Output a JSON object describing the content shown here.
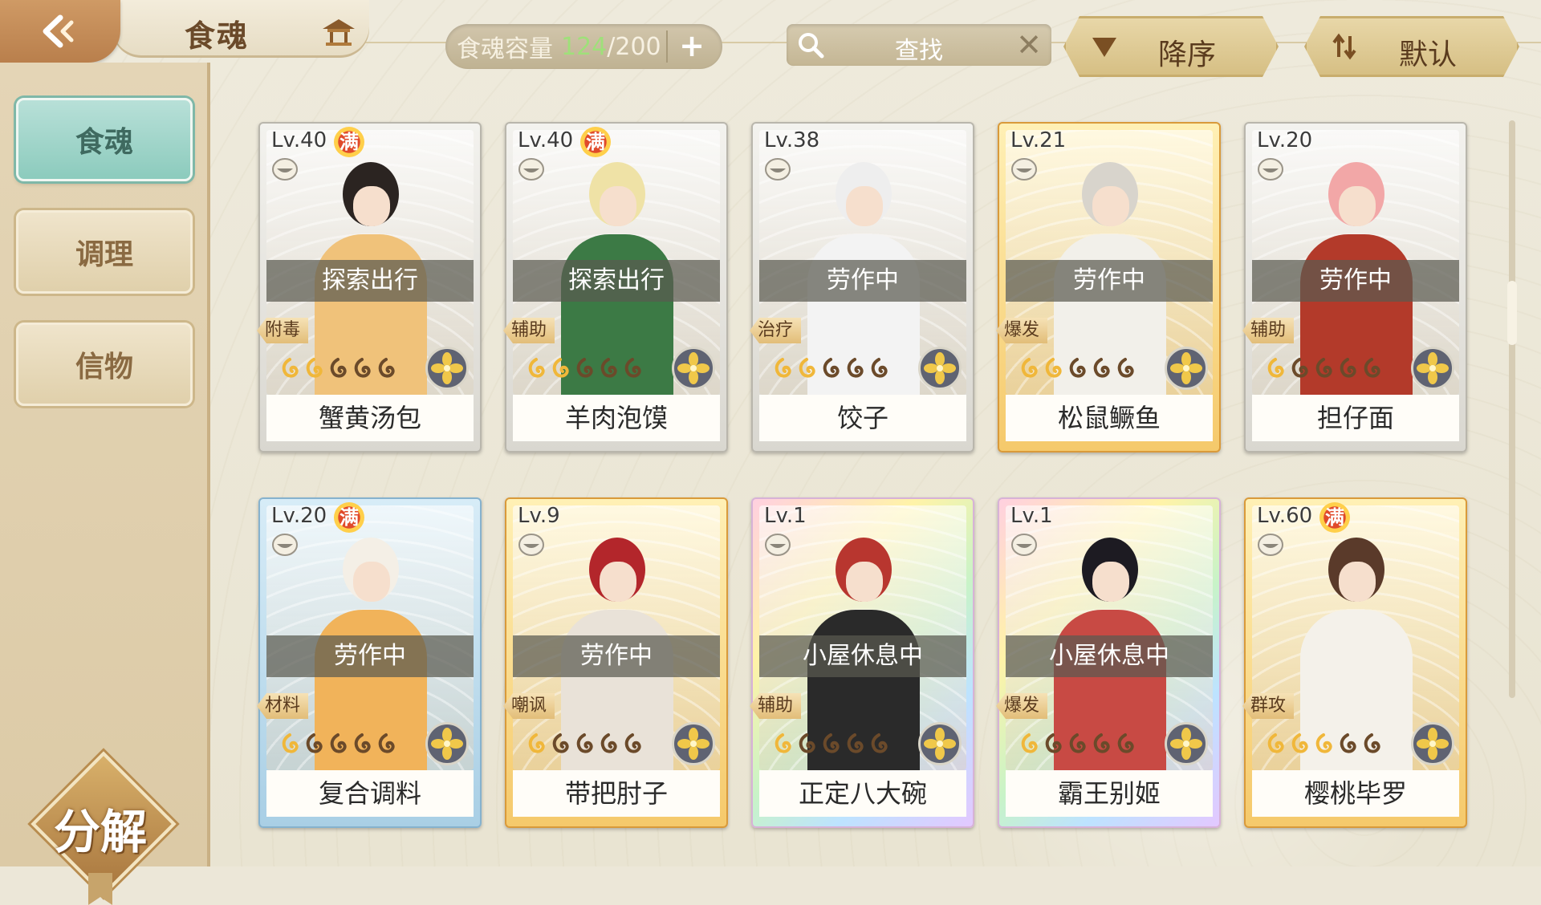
{
  "header": {
    "title": "食魂",
    "capacity_label": "食魂容量",
    "capacity_current": "124",
    "capacity_max": "/200",
    "plus_label": "+",
    "search_label": "查找",
    "clear_label": "✕",
    "sort_order_label": "降序",
    "sort_mode_label": "默认"
  },
  "sidebar": {
    "items": [
      {
        "label": "食魂",
        "active": true
      },
      {
        "label": "调理",
        "active": false
      },
      {
        "label": "信物",
        "active": false
      }
    ],
    "decompose_label": "分解"
  },
  "colors": {
    "accent_teal": "#8ccbbd",
    "gold": "#e2bd78",
    "status_overlay": "#5a5a50"
  },
  "cards": [
    {
      "level": "Lv.40",
      "full": true,
      "full_label": "满",
      "status": "探索出行",
      "role": "附毒",
      "name": "蟹黄汤包",
      "stars_filled": 2,
      "rarity": "silver"
    },
    {
      "level": "Lv.40",
      "full": true,
      "full_label": "满",
      "status": "探索出行",
      "role": "辅助",
      "name": "羊肉泡馍",
      "stars_filled": 2,
      "rarity": "silver"
    },
    {
      "level": "Lv.38",
      "full": false,
      "full_label": "",
      "status": "劳作中",
      "role": "治疗",
      "name": "饺子",
      "stars_filled": 2,
      "rarity": "silver"
    },
    {
      "level": "Lv.21",
      "full": false,
      "full_label": "",
      "status": "劳作中",
      "role": "爆发",
      "name": "松鼠鳜鱼",
      "stars_filled": 2,
      "rarity": "gold"
    },
    {
      "level": "Lv.20",
      "full": false,
      "full_label": "",
      "status": "劳作中",
      "role": "辅助",
      "name": "担仔面",
      "stars_filled": 1,
      "rarity": "silver"
    },
    {
      "level": "Lv.20",
      "full": true,
      "full_label": "满",
      "status": "劳作中",
      "role": "材料",
      "name": "复合调料",
      "stars_filled": 1,
      "rarity": "blue"
    },
    {
      "level": "Lv.9",
      "full": false,
      "full_label": "",
      "status": "劳作中",
      "role": "嘲讽",
      "name": "带把肘子",
      "stars_filled": 1,
      "rarity": "gold"
    },
    {
      "level": "Lv.1",
      "full": false,
      "full_label": "",
      "status": "小屋休息中",
      "role": "辅助",
      "name": "正定八大碗",
      "stars_filled": 1,
      "rarity": "rainbow"
    },
    {
      "level": "Lv.1",
      "full": false,
      "full_label": "",
      "status": "小屋休息中",
      "role": "爆发",
      "name": "霸王别姬",
      "stars_filled": 1,
      "rarity": "rainbow"
    },
    {
      "level": "Lv.60",
      "full": true,
      "full_label": "满",
      "status": "",
      "role": "群攻",
      "name": "樱桃毕罗",
      "stars_filled": 3,
      "rarity": "gold"
    }
  ]
}
